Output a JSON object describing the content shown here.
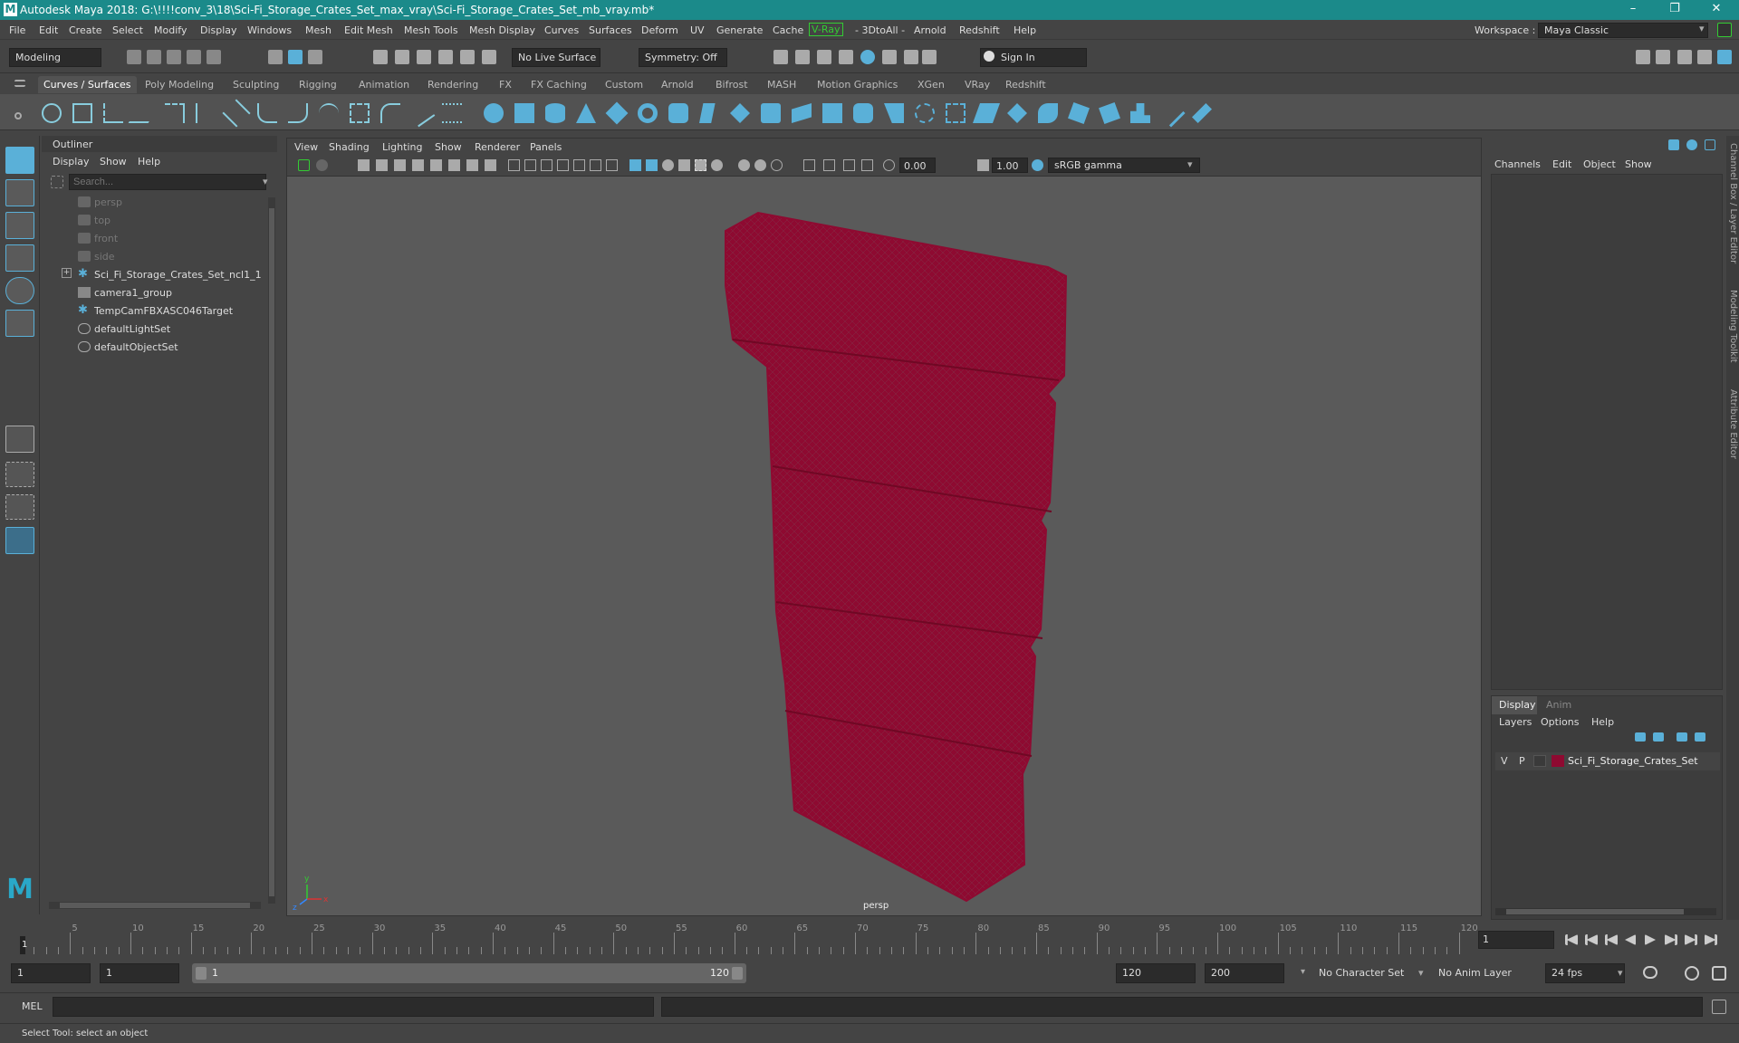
{
  "title": {
    "text": "Autodesk Maya 2018: G:\\!!!!conv_3\\18\\Sci-Fi_Storage_Crates_Set_max_vray\\Sci-Fi_Storage_Crates_Set_mb_vray.mb*",
    "app_icon": "M"
  },
  "window_controls": {
    "minimize": "–",
    "maximize": "❐",
    "close": "✕"
  },
  "menus": [
    "File",
    "Edit",
    "Create",
    "Select",
    "Modify",
    "Display",
    "Windows",
    "Mesh",
    "Edit Mesh",
    "Mesh Tools",
    "Mesh Display",
    "Curves",
    "Surfaces",
    "Deform",
    "UV",
    "Generate",
    "Cache",
    "V-Ray",
    "- 3DtoAll -",
    "Arnold",
    "Redshift",
    "Help"
  ],
  "workspace": {
    "label": "Workspace :",
    "value": "Maya Classic"
  },
  "status": {
    "mode": "Modeling",
    "live_surface": "No Live Surface",
    "symmetry": "Symmetry: Off",
    "sign_in": "Sign In"
  },
  "shelf_tabs": [
    "Curves / Surfaces",
    "Poly Modeling",
    "Sculpting",
    "Rigging",
    "Animation",
    "Rendering",
    "FX",
    "FX Caching",
    "Custom",
    "Arnold",
    "Bifrost",
    "MASH",
    "Motion Graphics",
    "XGen",
    "VRay",
    "Redshift"
  ],
  "outliner": {
    "title": "Outliner",
    "menus": [
      "Display",
      "Show",
      "Help"
    ],
    "search_placeholder": "Search...",
    "items": [
      "persp",
      "top",
      "front",
      "side",
      "Sci_Fi_Storage_Crates_Set_ncl1_1",
      "camera1_group",
      "TempCamFBXASC046Target",
      "defaultLightSet",
      "defaultObjectSet"
    ],
    "expander": "+"
  },
  "viewport": {
    "menus": [
      "View",
      "Shading",
      "Lighting",
      "Show",
      "Renderer",
      "Panels"
    ],
    "field1": "0.00",
    "field2": "1.00",
    "colorspace": "sRGB gamma",
    "camera_label": "persp",
    "mesh_color": "#8e0a31",
    "axis_labels": [
      "y",
      "x",
      "z"
    ]
  },
  "channel_box": {
    "menus": [
      "Channels",
      "Edit",
      "Object",
      "Show"
    ]
  },
  "layer_editor": {
    "tabs": [
      "Display",
      "Anim"
    ],
    "menus": [
      "Layers",
      "Options",
      "Help"
    ],
    "layer": {
      "v": "V",
      "p": "P",
      "name": "Sci_Fi_Storage_Crates_Set",
      "color": "#8e0a31"
    }
  },
  "side_tabs": [
    "Channel Box / Layer Editor",
    "Modeling Toolkit",
    "Attribute Editor"
  ],
  "timeline": {
    "ticks": [
      "5",
      "10",
      "15",
      "20",
      "25",
      "30",
      "35",
      "40",
      "45",
      "50",
      "55",
      "60",
      "65",
      "70",
      "75",
      "80",
      "85",
      "90",
      "95",
      "100",
      "105",
      "110",
      "115",
      "120"
    ],
    "start_marker": "1",
    "current_frame": "1"
  },
  "range": {
    "start": "1",
    "playback_start": "1",
    "slider_start": "1",
    "slider_end": "120",
    "playback_end": "120",
    "end": "200",
    "character_set": "No Character Set",
    "anim_layer": "No Anim Layer",
    "fps": "24 fps"
  },
  "command": {
    "label": "MEL"
  },
  "help_text": "Select Tool: select an object"
}
